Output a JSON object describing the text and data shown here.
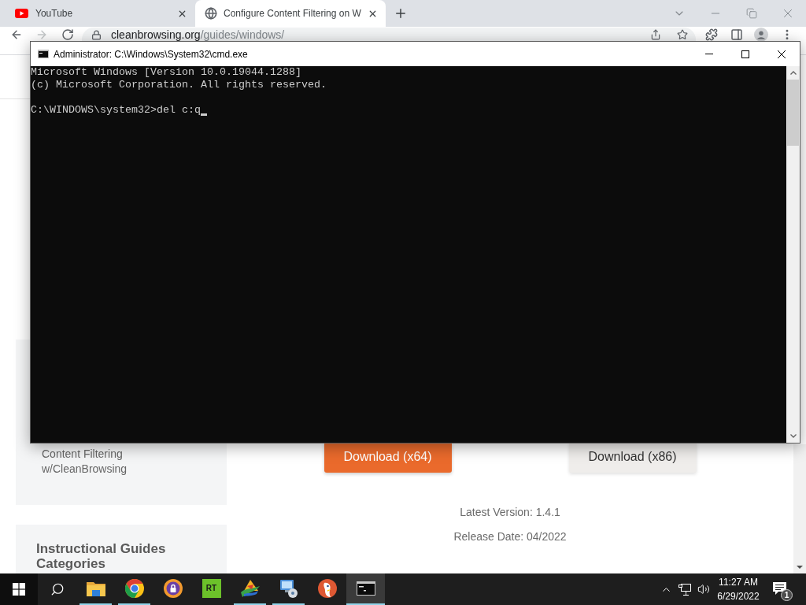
{
  "browser": {
    "tabs": [
      {
        "title": "YouTube",
        "kind": "video",
        "selected": false
      },
      {
        "title": "Configure Content Filtering on W",
        "kind": "web",
        "selected": true
      }
    ],
    "toolbar": {
      "back_disabled": false,
      "forward_disabled": true,
      "url": "cleanbrowsing.org/guides/windows/"
    }
  },
  "page": {
    "sidebar_cards": [
      {
        "kind": "link",
        "text": "Content Filtering w/CleanBrowsing"
      },
      {
        "kind": "heading",
        "text": "Instructional Guides Categories"
      }
    ],
    "downloads": [
      {
        "label": "Download (x64)",
        "kind": "primary"
      },
      {
        "label": "Download (x86)",
        "kind": "secondary"
      }
    ],
    "details": [
      "Latest Version: 1.4.1",
      "Release Date: 04/2022"
    ]
  },
  "console": {
    "title": "Administrator: C:\\Windows\\System32\\cmd.exe",
    "output": [
      "Microsoft Windows [Version 10.0.19044.1288]",
      "(c) Microsoft Corporation. All rights reserved."
    ],
    "prompt_line": "C:\\WINDOWS\\system32>del c:q",
    "cursor_visible": true
  },
  "taskbar": {
    "apps": [
      {
        "kind": "folder",
        "running": true,
        "selected": false
      },
      {
        "kind": "browser",
        "running": true,
        "selected": false
      },
      {
        "kind": "lock",
        "running": false,
        "selected": false
      },
      {
        "kind": "tile",
        "label": "RT",
        "running": false,
        "selected": false
      },
      {
        "kind": "swirl",
        "running": true,
        "selected": false
      },
      {
        "kind": "computer",
        "running": true,
        "selected": false
      },
      {
        "kind": "bird",
        "running": false,
        "selected": false
      },
      {
        "kind": "terminal",
        "running": true,
        "selected": true
      }
    ],
    "clock": {
      "time": "11:27 AM",
      "date": "6/29/2022"
    },
    "notifications": "1"
  }
}
